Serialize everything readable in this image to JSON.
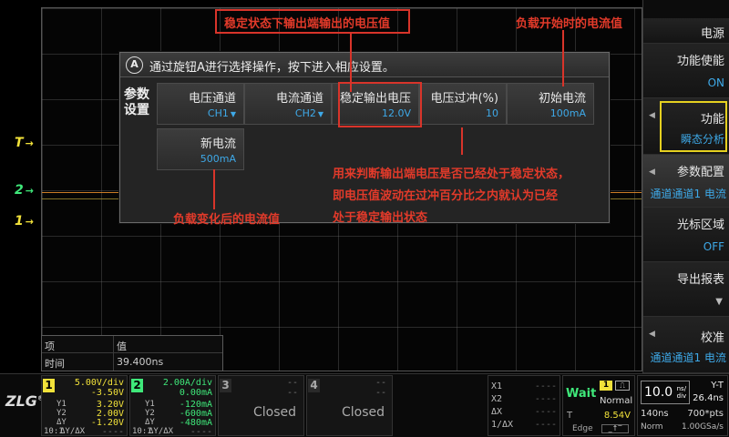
{
  "dialog": {
    "hint": "通过旋钮A进行选择操作，按下进入相应设置。",
    "hint_icon": "A",
    "side_label": "参数设置",
    "params": [
      {
        "label": "电压通道",
        "value": "CH1",
        "dropdown": true
      },
      {
        "label": "电流通道",
        "value": "CH2",
        "dropdown": true
      },
      {
        "label": "稳定输出电压",
        "value": "12.0V",
        "dropdown": false
      },
      {
        "label": "电压过冲(%)",
        "value": "10",
        "dropdown": false
      },
      {
        "label": "初始电流",
        "value": "100mA",
        "dropdown": false
      },
      {
        "label": "新电流",
        "value": "500mA",
        "dropdown": false
      }
    ]
  },
  "annotations": {
    "stable_voltage": "稳定状态下输出端输出的电压值",
    "initial_current": "负载开始时的电流值",
    "overshoot_line1": "用来判断输出端电压是否已经处于稳定状态，",
    "overshoot_line2": "即电压值波动在过冲百分比之内就认为已经",
    "overshoot_line3": "处于稳定输出状态",
    "new_current": "负载变化后的电流值"
  },
  "markers": {
    "trigger": "T",
    "ch2": "2",
    "ch1": "1"
  },
  "side_menu": {
    "title": "电源",
    "items": [
      {
        "label": "功能使能",
        "value": "ON"
      },
      {
        "label": "功能",
        "value": "瞬态分析"
      },
      {
        "label": "参数配置",
        "value": "通道通道1 电流"
      },
      {
        "label": "光标区域",
        "value": "OFF"
      },
      {
        "label": "导出报表",
        "value": ""
      },
      {
        "label": "校准",
        "value": "通道通道1 电流"
      }
    ]
  },
  "measurement": {
    "headers": [
      "项",
      "值"
    ],
    "rows": [
      [
        "时间",
        "39.400ns"
      ]
    ]
  },
  "channels": {
    "ch1": {
      "num": "1",
      "scale": "5.00V/div",
      "offset": "-3.50V",
      "y1_label": "Y1",
      "y1": "3.20V",
      "y2_label": "Y2",
      "y2": "2.00V",
      "dy_label": "ΔY",
      "dy": "-1.20V",
      "probe": "10:1",
      "dydx": "ΔY/ΔX",
      "dydx_val": "----"
    },
    "ch2": {
      "num": "2",
      "scale": "2.00A/div",
      "offset": "0.00mA",
      "y1_label": "Y1",
      "y1": "-120mA",
      "y2_label": "Y2",
      "y2": "-600mA",
      "dy_label": "ΔY",
      "dy": "-480mA",
      "probe": "10:1",
      "dydx": "ΔY/ΔX",
      "dydx_val": "----"
    },
    "ch3": {
      "num": "3",
      "status": "Closed",
      "dash": "--"
    },
    "ch4": {
      "num": "4",
      "status": "Closed",
      "dash": "--"
    }
  },
  "cursors": [
    {
      "label": "X1",
      "value": "----"
    },
    {
      "label": "X2",
      "value": "----"
    },
    {
      "label": "ΔX",
      "value": "----"
    },
    {
      "label": "1/ΔX",
      "value": "----"
    }
  ],
  "trigger": {
    "state": "Wait",
    "source": "1",
    "mode": "Normal",
    "level_label": "T",
    "level": "8.54V",
    "type": "Edge"
  },
  "timebase": {
    "scale": "10.0",
    "unit_top": "ns/",
    "unit_bottom": "div",
    "mode": "Y-T",
    "delay": "26.4ns",
    "position": "140ns",
    "points": "700*pts",
    "acq": "Norm",
    "rate": "1.00GSa/s"
  },
  "logo": "ZLG",
  "colors": {
    "ch1": "#f2e23a",
    "ch2": "#3fe87a",
    "accent_blue": "#3ea9e8",
    "annotation": "#e23a2a",
    "menu_highlight": "#e5d020"
  }
}
